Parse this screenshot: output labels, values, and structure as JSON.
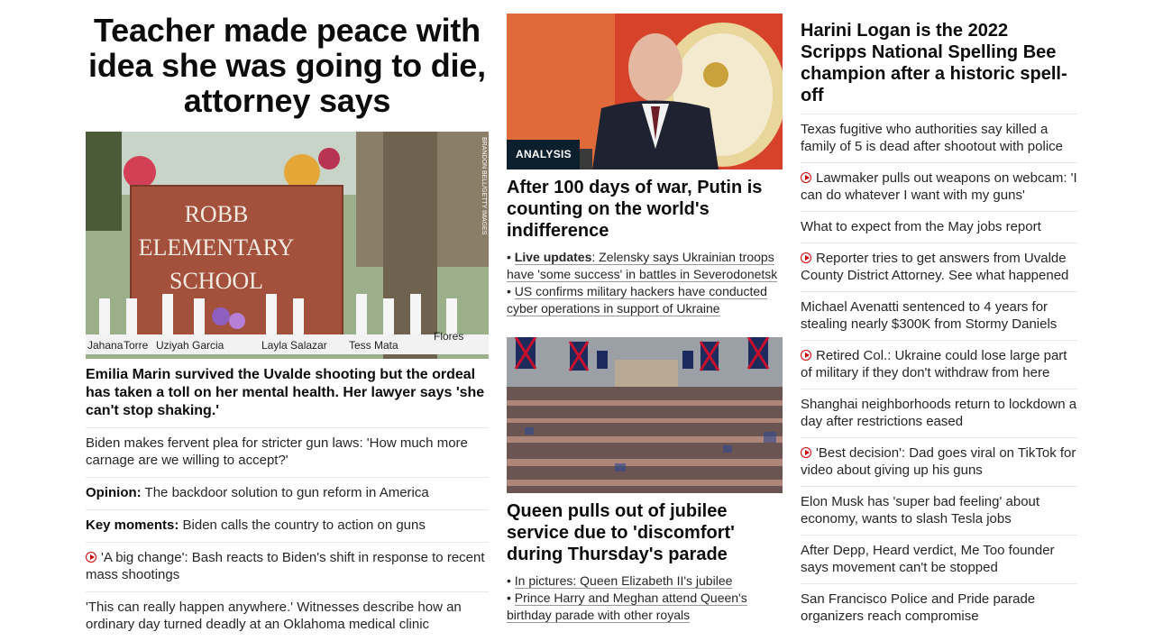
{
  "col1": {
    "headline": "Teacher made peace with idea she was going to die, attorney says",
    "image_credit": "BRANDON BELL/GETTY IMAGES",
    "sign_lines": [
      "ROBB",
      "ELEMENTARY",
      "SCHOOL"
    ],
    "cross_names": [
      "Jahana",
      "Torre",
      "Uziyah Garcia",
      "Layla Salazar",
      "Tess Mata",
      "Flores"
    ],
    "caption": "Emilia Marin survived the Uvalde shooting but the ordeal has taken a toll on her mental health. Her lawyer says 'she can't stop shaking.'",
    "items": [
      {
        "prefix": "",
        "text": "Biden makes fervent plea for stricter gun laws: 'How much more carnage are we willing to accept?'",
        "video": false
      },
      {
        "prefix": "Opinion:",
        "text": " The backdoor solution to gun reform in America",
        "video": false
      },
      {
        "prefix": "Key moments:",
        "text": " Biden calls the country to action on guns",
        "video": false
      },
      {
        "prefix": "",
        "text": "'A big change': Bash reacts to Biden's shift in response to recent mass shootings",
        "video": true
      },
      {
        "prefix": "",
        "text": "'This can really happen anywhere.' Witnesses describe how an ordinary day turned deadly at an Oklahoma medical clinic",
        "video": false
      }
    ]
  },
  "col2": {
    "badge": "ANALYSIS",
    "story1": {
      "headline": "After 100 days of war, Putin is counting on the world's indifference",
      "bullet1_bold": "Live updates",
      "bullet1_text": ": Zelensky says Ukrainian troops have 'some success' in battles in Severodonetsk",
      "bullet2_text": "US confirms military hackers have conducted cyber operations in support of Ukraine"
    },
    "story2": {
      "headline": "Queen pulls out of jubilee service due to 'discomfort' during Thursday's parade",
      "bullet1_text": "In pictures: Queen Elizabeth II's jubilee",
      "bullet2_text": "Prince Harry and Meghan attend Queen's birthday parade with other royals"
    }
  },
  "col3": {
    "headline": "Harini Logan is the 2022 Scripps National Spelling Bee champion after a historic spell-off",
    "items": [
      {
        "text": "Texas fugitive who authorities say killed a family of 5 is dead after shootout with police",
        "video": false
      },
      {
        "text": "Lawmaker pulls out weapons on webcam: 'I can do whatever I want with my guns'",
        "video": true
      },
      {
        "text": "What to expect from the May jobs report",
        "video": false
      },
      {
        "text": "Reporter tries to get answers from Uvalde County District Attorney. See what happened",
        "video": true
      },
      {
        "text": "Michael Avenatti sentenced to 4 years for stealing nearly $300K from Stormy Daniels",
        "video": false
      },
      {
        "text": "Retired Col.: Ukraine could lose large part of military if they don't withdraw from here",
        "video": true
      },
      {
        "text": "Shanghai neighborhoods return to lockdown a day after restrictions eased",
        "video": false
      },
      {
        "text": "'Best decision': Dad goes viral on TikTok for video about giving up his guns",
        "video": true
      },
      {
        "text": "Elon Musk has 'super bad feeling' about economy, wants to slash Tesla jobs",
        "video": false
      },
      {
        "text": "After Depp, Heard verdict, Me Too founder says movement can't be stopped",
        "video": false
      },
      {
        "text": "San Francisco Police and Pride parade organizers reach compromise",
        "video": false
      }
    ]
  },
  "colors": {
    "accent_red": "#cc0000",
    "badge_bg": "#0c1f2d",
    "divider": "#e6e6e6"
  },
  "icons": {
    "video": "play-circle-icon"
  }
}
